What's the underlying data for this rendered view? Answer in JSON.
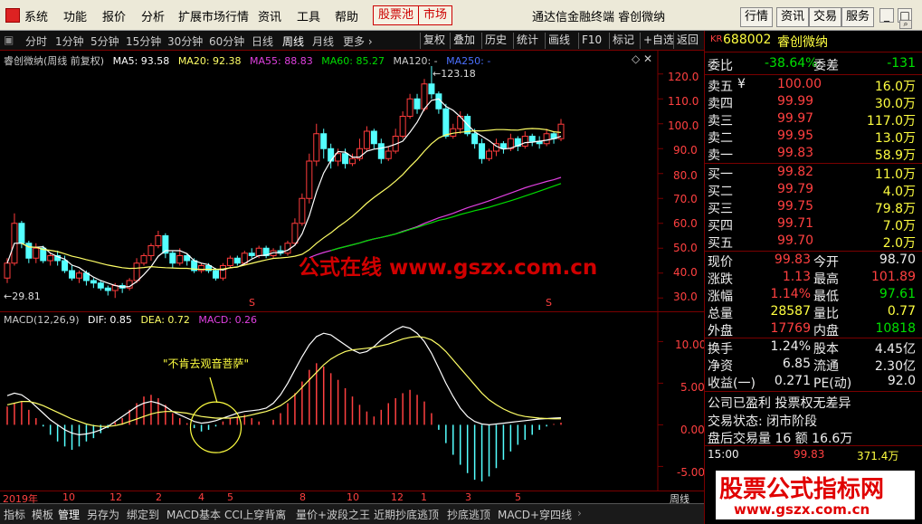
{
  "menubar": {
    "items": [
      "系统",
      "功能",
      "报价",
      "分析",
      "扩展市场行情",
      "资讯",
      "工具",
      "帮助"
    ],
    "stock_pool": "股票池",
    "market": "市场",
    "title": "通达信金融终端  睿创微纳",
    "right_buttons": [
      "行情",
      "资讯",
      "交易",
      "服务"
    ]
  },
  "periodbar": {
    "periods": [
      "分时",
      "1分钟",
      "5分钟",
      "15分钟",
      "30分钟",
      "60分钟",
      "日线",
      "周线",
      "月线",
      "更多 ›"
    ],
    "active": "周线",
    "tools": [
      "复权",
      "叠加",
      "历史",
      "统计",
      "画线",
      "F10",
      "标记",
      "+自选",
      "返回"
    ]
  },
  "kline": {
    "caption": "睿创微纳(周线 前复权)",
    "ma5": "MA5: 93.58",
    "ma20": "MA20: 92.38",
    "ma55": "MA55: 88.83",
    "ma60": "MA60: 85.27",
    "ma120": "MA120: -",
    "ma250": "MA250: -",
    "high_label": "123.18",
    "low_label": "29.81",
    "watermark": "公式在线 www.gszx.com.cn",
    "y_labels": [
      "120.0",
      "110.0",
      "100.0",
      "90.0",
      "80.0",
      "70.0",
      "60.0",
      "50.0",
      "40.0",
      "30.0"
    ],
    "colors": {
      "up": "#ff3c3c",
      "down": "#54ffff",
      "ma5": "#ffffff",
      "ma20": "#ffff66",
      "ma55": "#e040e0",
      "ma60": "#00dd00"
    }
  },
  "macd": {
    "caption": "MACD(12,26,9)",
    "dif": "DIF: 0.85",
    "dea": "DEA: 0.72",
    "macd": "MACD: 0.26",
    "annotation": "\"不肯去观音菩萨\"",
    "y_labels": [
      "10.00",
      "5.00",
      "0.00",
      "-5.00"
    ]
  },
  "datebar": {
    "labels": [
      "2019年",
      "10",
      "12",
      "2",
      "4",
      "5",
      "8",
      "10",
      "12",
      "1",
      "3",
      "5"
    ],
    "period": "周线"
  },
  "tabbar": {
    "tabs": [
      "指标",
      "模板",
      "管理",
      "另存为",
      "绑定到",
      "MACD基本",
      "CCI上穿背离",
      "量价+波段之王",
      "近期抄底逃顶",
      "抄底逃顶",
      "MACD+穿四线"
    ],
    "active": "管理"
  },
  "quote": {
    "tag": "KR",
    "code": "688002",
    "name": "睿创微纳",
    "wei_bi_label": "委比",
    "wei_bi": "-38.64%",
    "wei_cha_label": "委差",
    "wei_cha": "-131",
    "asks": [
      {
        "label": "卖五",
        "mark": "¥",
        "price": "100.00",
        "vol": "16.0万"
      },
      {
        "label": "卖四",
        "mark": "",
        "price": "99.99",
        "vol": "30.0万"
      },
      {
        "label": "卖三",
        "mark": "",
        "price": "99.97",
        "vol": "117.0万"
      },
      {
        "label": "卖二",
        "mark": "",
        "price": "99.95",
        "vol": "13.0万"
      },
      {
        "label": "卖一",
        "mark": "",
        "price": "99.83",
        "vol": "58.9万"
      }
    ],
    "bids": [
      {
        "label": "买一",
        "price": "99.82",
        "vol": "11.0万"
      },
      {
        "label": "买二",
        "price": "99.79",
        "vol": "4.0万"
      },
      {
        "label": "买三",
        "price": "99.75",
        "vol": "79.8万"
      },
      {
        "label": "买四",
        "price": "99.71",
        "vol": "7.0万"
      },
      {
        "label": "买五",
        "price": "99.70",
        "vol": "2.0万"
      }
    ],
    "stats": [
      {
        "l1": "现价",
        "v1": "99.83",
        "c1": "red",
        "l2": "今开",
        "v2": "98.70",
        "c2": "white"
      },
      {
        "l1": "涨跌",
        "v1": "1.13",
        "c1": "red",
        "l2": "最高",
        "v2": "101.89",
        "c2": "red"
      },
      {
        "l1": "涨幅",
        "v1": "1.14%",
        "c1": "red",
        "l2": "最低",
        "v2": "97.61",
        "c2": "green"
      },
      {
        "l1": "总量",
        "v1": "28587",
        "c1": "yellow",
        "l2": "量比",
        "v2": "0.77",
        "c2": "yellow"
      },
      {
        "l1": "外盘",
        "v1": "17769",
        "c1": "red",
        "l2": "内盘",
        "v2": "10818",
        "c2": "green"
      }
    ],
    "stats2": [
      {
        "l1": "换手",
        "v1": "1.24%",
        "l2": "股本",
        "v2": "4.45亿"
      },
      {
        "l1": "净资",
        "v1": "6.85",
        "l2": "流通",
        "v2": "2.30亿"
      },
      {
        "l1": "收益(一)",
        "v1": "0.271",
        "l2": "PE(动)",
        "v2": "92.0"
      }
    ],
    "info1": "公司已盈利 投票权无差异",
    "info2": "交易状态: 闭市阶段",
    "info3": "盘后交易量 16 额 16.6万",
    "tick": {
      "time": "15:00",
      "price": "99.83",
      "vol": "371.4万"
    },
    "watermark_big": "股票公式指标网",
    "watermark_small": "www.gszx.com.cn"
  },
  "chart_data": [
    {
      "type": "candlestick",
      "title": "睿创微纳(周线 前复权)",
      "ylim": [
        25,
        125
      ],
      "high": 123.18,
      "low": 29.81,
      "candles": [
        [
          38,
          44,
          36,
          46
        ],
        [
          44,
          60,
          43,
          64
        ],
        [
          60,
          52,
          50,
          61
        ],
        [
          52,
          46,
          44,
          53
        ],
        [
          46,
          50,
          44,
          52
        ],
        [
          50,
          45,
          44,
          51
        ],
        [
          45,
          47,
          43,
          48
        ],
        [
          47,
          45,
          43,
          49
        ],
        [
          45,
          41,
          40,
          47
        ],
        [
          41,
          38,
          37,
          43
        ],
        [
          38,
          40,
          36,
          41
        ],
        [
          40,
          37,
          35,
          41
        ],
        [
          37,
          36,
          34,
          38
        ],
        [
          36,
          34,
          33,
          37
        ],
        [
          34,
          33,
          31,
          35
        ],
        [
          33,
          35,
          30,
          36
        ],
        [
          35,
          34,
          32,
          36
        ],
        [
          34,
          37,
          33,
          38
        ],
        [
          37,
          44,
          36,
          46
        ],
        [
          44,
          47,
          43,
          48
        ],
        [
          47,
          51,
          45,
          52
        ],
        [
          51,
          55,
          50,
          57
        ],
        [
          55,
          48,
          46,
          56
        ],
        [
          48,
          44,
          42,
          49
        ],
        [
          44,
          47,
          43,
          50
        ],
        [
          47,
          45,
          43,
          48
        ],
        [
          45,
          41,
          40,
          46
        ],
        [
          41,
          43,
          40,
          44
        ],
        [
          43,
          41,
          40,
          44
        ],
        [
          41,
          38,
          37,
          42
        ],
        [
          38,
          43,
          37,
          44
        ],
        [
          43,
          46,
          42,
          47
        ],
        [
          46,
          44,
          43,
          47
        ],
        [
          44,
          48,
          43,
          49
        ],
        [
          48,
          47,
          46,
          50
        ],
        [
          47,
          50,
          46,
          51
        ],
        [
          50,
          47,
          46,
          51
        ],
        [
          47,
          49,
          46,
          50
        ],
        [
          49,
          48,
          47,
          51
        ],
        [
          48,
          52,
          47,
          53
        ],
        [
          52,
          60,
          51,
          62
        ],
        [
          60,
          70,
          59,
          72
        ],
        [
          70,
          85,
          68,
          88
        ],
        [
          85,
          96,
          83,
          100
        ],
        [
          96,
          90,
          86,
          98
        ],
        [
          90,
          85,
          82,
          92
        ],
        [
          85,
          88,
          83,
          90
        ],
        [
          88,
          84,
          82,
          90
        ],
        [
          84,
          86,
          83,
          88
        ],
        [
          86,
          90,
          85,
          94
        ],
        [
          90,
          97,
          89,
          99
        ],
        [
          97,
          92,
          90,
          98
        ],
        [
          92,
          86,
          84,
          94
        ],
        [
          86,
          89,
          85,
          91
        ],
        [
          89,
          95,
          88,
          98
        ],
        [
          95,
          103,
          94,
          105
        ],
        [
          103,
          110,
          102,
          112
        ],
        [
          110,
          106,
          104,
          112
        ],
        [
          106,
          116,
          105,
          118
        ],
        [
          116,
          112,
          110,
          123.18
        ],
        [
          112,
          106,
          104,
          113
        ],
        [
          106,
          95,
          94,
          108
        ],
        [
          95,
          98,
          94,
          100
        ],
        [
          98,
          103,
          96,
          105
        ],
        [
          103,
          96,
          95,
          104
        ],
        [
          96,
          92,
          90,
          98
        ],
        [
          92,
          86,
          84,
          94
        ],
        [
          86,
          89,
          85,
          90
        ],
        [
          89,
          92,
          87,
          94
        ],
        [
          92,
          90,
          88,
          93
        ],
        [
          90,
          94,
          89,
          96
        ],
        [
          94,
          91,
          89,
          95
        ],
        [
          91,
          95,
          90,
          97
        ],
        [
          95,
          93,
          91,
          96
        ],
        [
          93,
          92,
          90,
          95
        ],
        [
          92,
          96,
          91,
          98
        ],
        [
          96,
          94,
          92,
          97
        ],
        [
          94,
          99.83,
          93,
          101.89
        ]
      ],
      "series": [
        {
          "name": "MA5",
          "last": 93.58
        },
        {
          "name": "MA20",
          "last": 92.38
        },
        {
          "name": "MA55",
          "last": 88.83
        },
        {
          "name": "MA60",
          "last": 85.27
        }
      ]
    },
    {
      "type": "bar",
      "title": "MACD(12,26,9)",
      "ylim": [
        -8,
        12
      ],
      "macd_hist": [
        2.2,
        2.6,
        2.8,
        1.8,
        0.8,
        -0.2,
        -1.2,
        -2.0,
        -2.6,
        -3.0,
        -2.6,
        -2.0,
        -1.6,
        -1.0,
        -0.4,
        0.3,
        0.8,
        1.8,
        2.6,
        3.4,
        3.6,
        3.2,
        2.4,
        1.4,
        0.8,
        0.2,
        -0.4,
        -0.8,
        -0.6,
        -0.2,
        0.4,
        0.8,
        1.0,
        1.2,
        0.8,
        0.4,
        0.0,
        0.6,
        1.4,
        2.6,
        3.8,
        5.2,
        6.6,
        7.4,
        7.0,
        6.2,
        5.4,
        4.4,
        3.4,
        2.4,
        1.6,
        1.0,
        1.8,
        2.6,
        3.2,
        3.8,
        4.2,
        3.6,
        2.8,
        1.4,
        -0.6,
        -2.2,
        -3.6,
        -4.8,
        -5.8,
        -6.6,
        -6.8,
        -6.2,
        -5.2,
        -4.2,
        -3.2,
        -2.4,
        -1.8,
        -1.2,
        -0.6,
        -0.2,
        0.1,
        0.26
      ],
      "dif": [
        3.5,
        3.8,
        3.6,
        3.0,
        2.2,
        1.4,
        0.6,
        0.0,
        -0.6,
        -1.0,
        -1.2,
        -1.1,
        -0.9,
        -0.6,
        -0.2,
        0.4,
        1.0,
        1.6,
        2.2,
        2.6,
        2.8,
        2.6,
        2.2,
        1.6,
        1.2,
        0.8,
        0.4,
        0.2,
        0.3,
        0.5,
        0.8,
        1.1,
        1.4,
        1.6,
        1.7,
        1.8,
        2.0,
        2.6,
        3.6,
        5.0,
        6.6,
        8.2,
        9.6,
        10.6,
        11.0,
        10.8,
        10.2,
        9.6,
        9.0,
        8.6,
        8.8,
        9.4,
        10.2,
        10.8,
        11.4,
        11.8,
        11.6,
        11.0,
        10.0,
        8.6,
        6.8,
        5.0,
        3.4,
        2.0,
        1.0,
        0.4,
        0.1,
        0.0,
        0.1,
        0.2,
        0.3,
        0.4,
        0.5,
        0.6,
        0.7,
        0.75,
        0.8,
        0.85
      ],
      "dea": [
        2.4,
        2.6,
        2.8,
        2.8,
        2.6,
        2.3,
        1.9,
        1.5,
        1.1,
        0.7,
        0.4,
        0.1,
        -0.1,
        -0.2,
        -0.2,
        -0.1,
        0.1,
        0.4,
        0.7,
        1.0,
        1.3,
        1.5,
        1.6,
        1.6,
        1.5,
        1.4,
        1.2,
        1.0,
        0.9,
        0.8,
        0.8,
        0.8,
        0.9,
        1.0,
        1.2,
        1.4,
        1.6,
        1.9,
        2.3,
        2.9,
        3.6,
        4.5,
        5.4,
        6.3,
        7.2,
        7.9,
        8.4,
        8.8,
        9.0,
        9.1,
        9.2,
        9.3,
        9.5,
        9.7,
        10.0,
        10.3,
        10.5,
        10.6,
        10.5,
        10.2,
        9.6,
        8.8,
        7.8,
        6.8,
        5.8,
        4.8,
        3.8,
        3.0,
        2.4,
        1.9,
        1.5,
        1.2,
        1.0,
        0.9,
        0.8,
        0.75,
        0.72,
        0.72
      ]
    }
  ]
}
